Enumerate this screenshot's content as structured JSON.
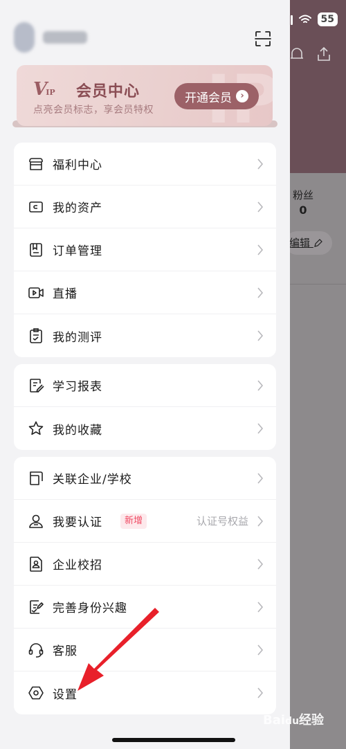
{
  "status_bar": {
    "battery": "55"
  },
  "background": {
    "fans_label": "粉丝",
    "fans_value": "0",
    "edit_label": "编辑"
  },
  "drawer": {
    "vip": {
      "logo_text": "V",
      "logo_sub": "IP",
      "title": "会员中心",
      "subtitle": "点亮会员标志，享会员特权",
      "button_label": "开通会员",
      "deco_text": "IP"
    },
    "group1": [
      {
        "label": "福利中心",
        "icon": "gift-box-icon"
      },
      {
        "label": "我的资产",
        "icon": "wallet-icon"
      },
      {
        "label": "订单管理",
        "icon": "order-icon"
      },
      {
        "label": "直播",
        "icon": "live-video-icon"
      },
      {
        "label": "我的测评",
        "icon": "clipboard-check-icon"
      }
    ],
    "group2": [
      {
        "label": "学习报表",
        "icon": "report-icon"
      },
      {
        "label": "我的收藏",
        "icon": "star-icon"
      }
    ],
    "group3": [
      {
        "label": "关联企业/学校",
        "icon": "link-org-icon"
      },
      {
        "label": "我要认证",
        "icon": "user-verify-icon",
        "badge": "新增",
        "extra": "认证号权益"
      },
      {
        "label": "企业校招",
        "icon": "id-card-icon"
      },
      {
        "label": "完善身份兴趣",
        "icon": "profile-edit-icon"
      },
      {
        "label": "客服",
        "icon": "headset-icon"
      },
      {
        "label": "设置",
        "icon": "settings-hexagon-icon"
      }
    ]
  },
  "watermark": {
    "text": "Bai",
    "text2": "du",
    "text3": "经验"
  }
}
